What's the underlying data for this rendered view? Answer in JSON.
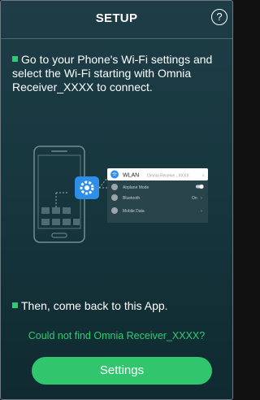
{
  "header": {
    "title": "SETUP",
    "help_icon": "?"
  },
  "step1": {
    "text": "Go to your Phone's Wi-Fi settings and select the Wi-Fi starting with Omnia Receiver_XXXX to connect."
  },
  "illustration": {
    "gear_icon": "gear-icon",
    "wifi_row": {
      "label": "WLAN",
      "value": "Omnia Receive...XXXX"
    },
    "airplane_row": {
      "label": "Airplane Mode"
    },
    "bluetooth_row": {
      "label": "Bluetooth",
      "value": "On"
    },
    "mobile_row": {
      "label": "Mobile Data"
    }
  },
  "step2": {
    "text": "Then, come back to this App."
  },
  "help_link": "Could not find Omnia Receiver_XXXX?",
  "settings_button": "Settings",
  "colors": {
    "accent": "#31c56e",
    "background": "#183840",
    "wifi_blue": "#2f8fe8"
  }
}
